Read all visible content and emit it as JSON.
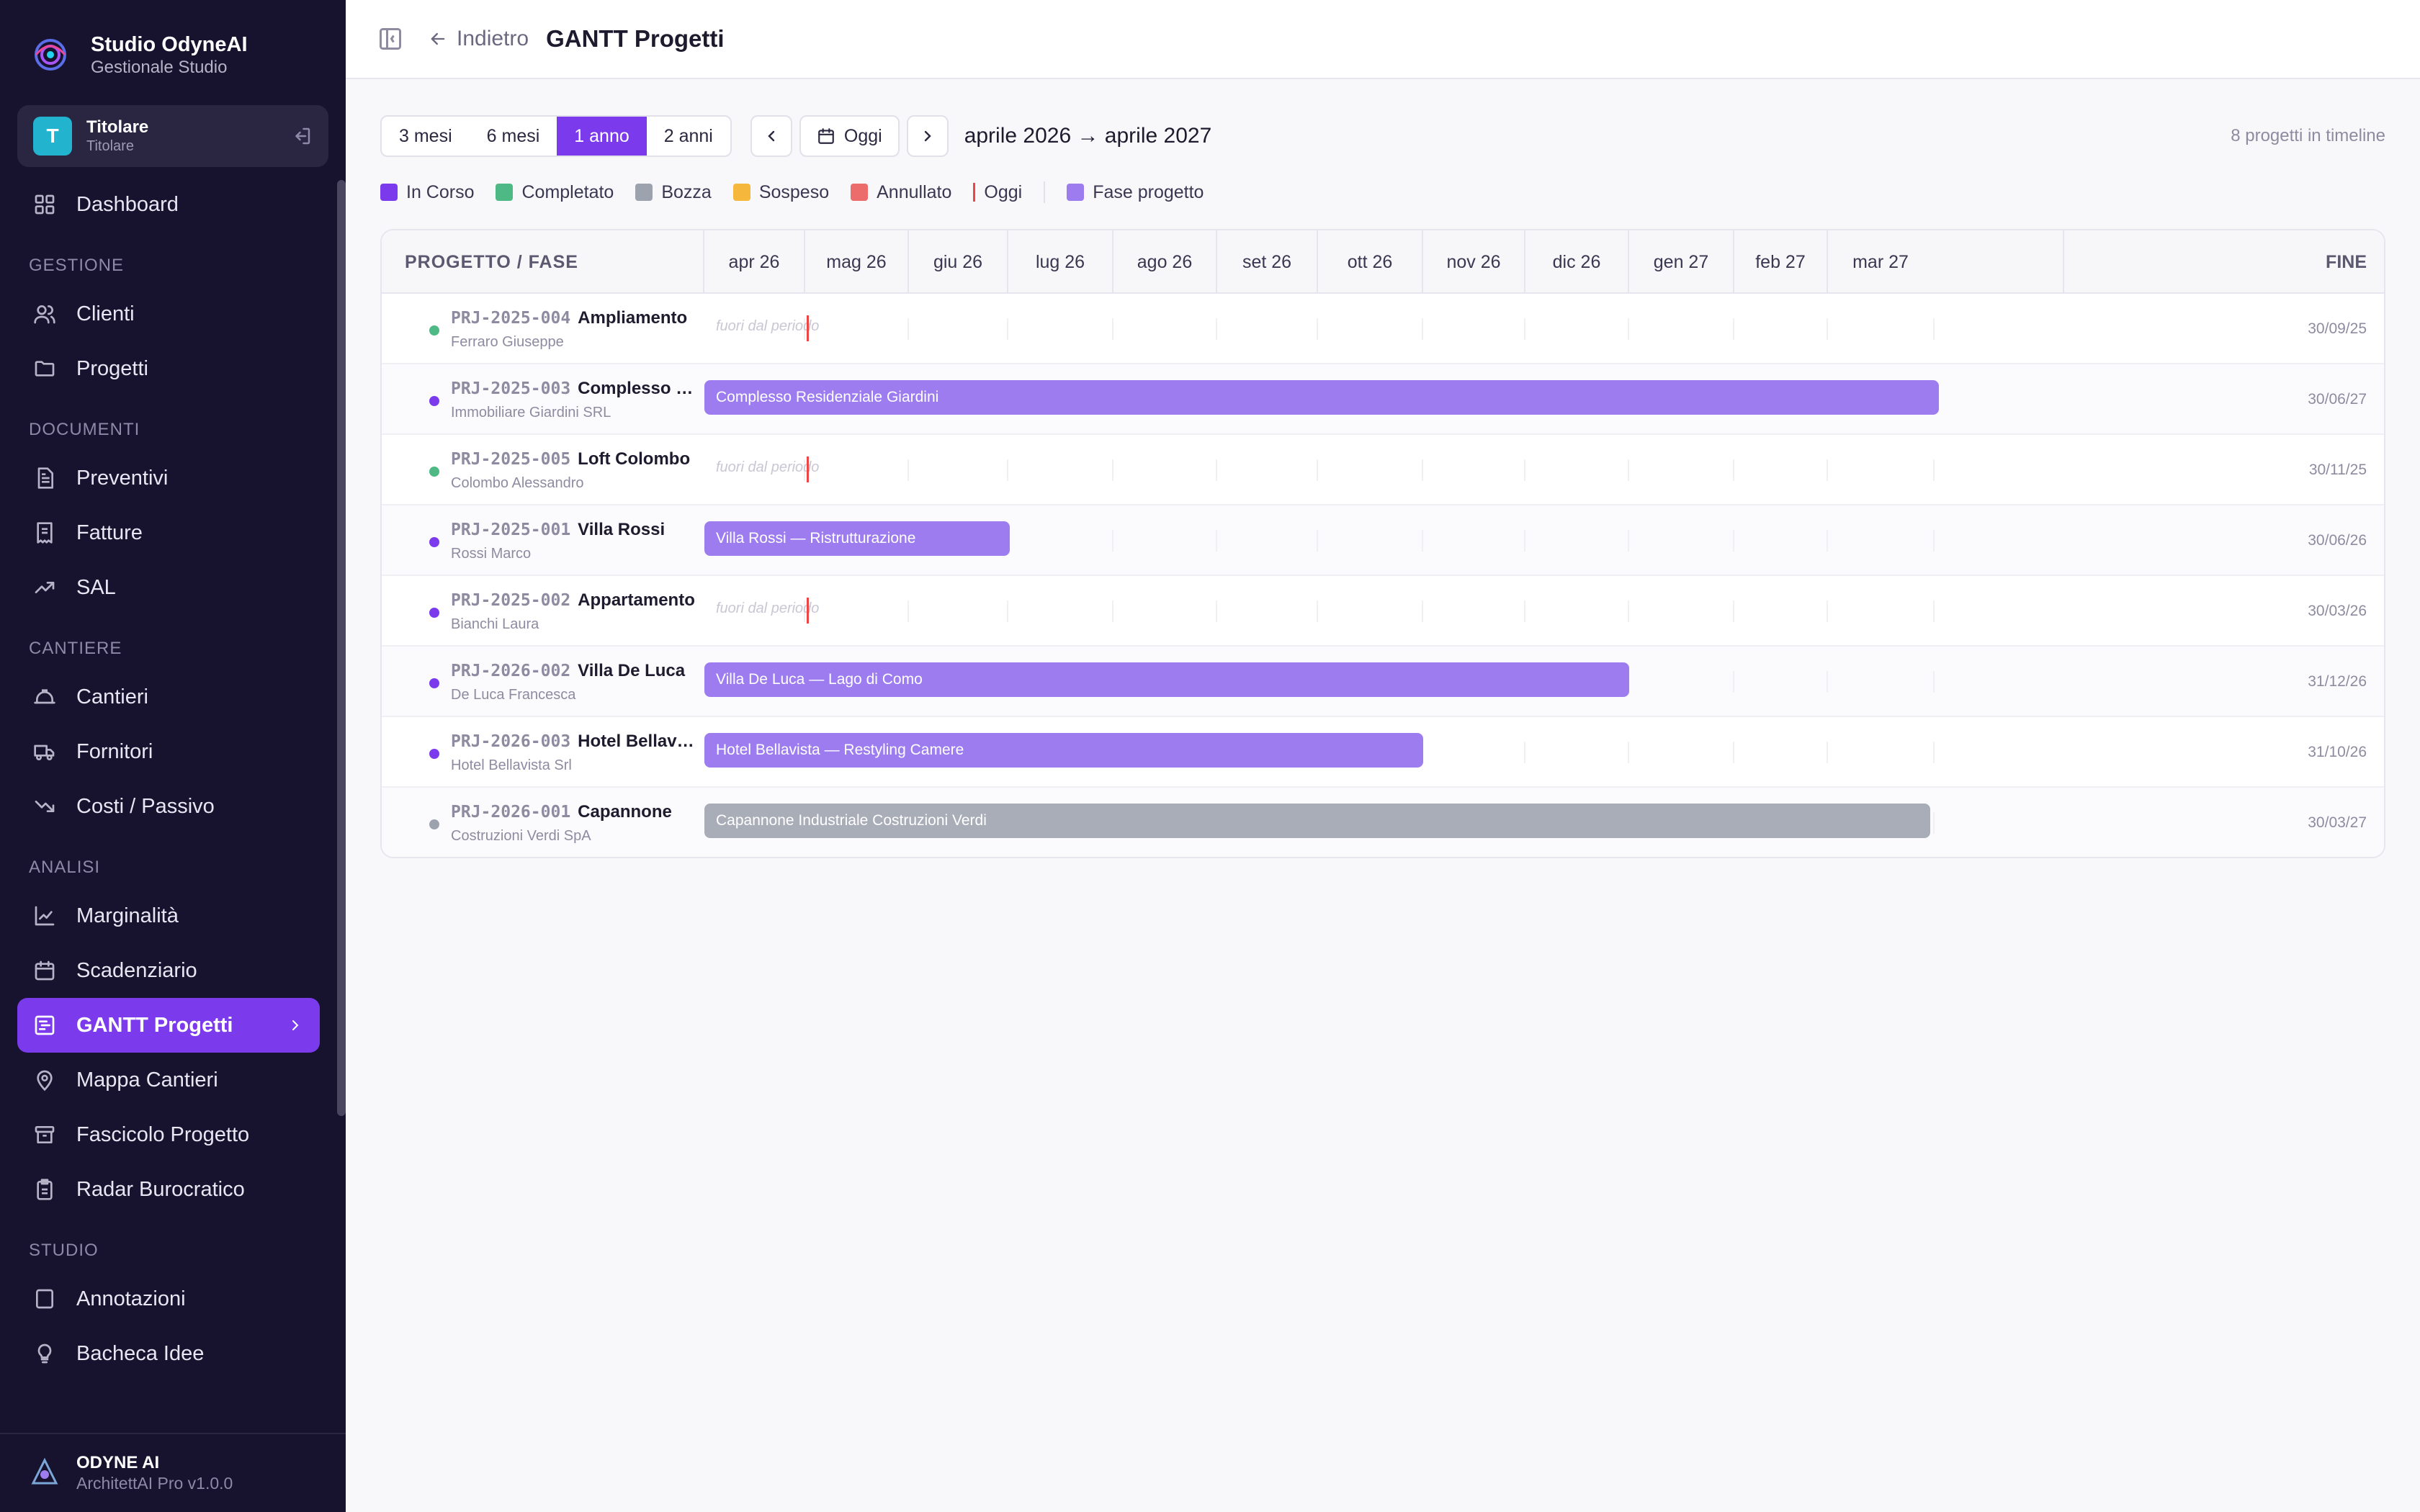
{
  "brand": {
    "title": "Studio OdyneAI",
    "subtitle": "Gestionale Studio"
  },
  "user": {
    "initial": "T",
    "name": "Titolare",
    "role": "Titolare"
  },
  "nav": {
    "dashboard": "Dashboard",
    "sections": {
      "gestione": "GESTIONE",
      "documenti": "DOCUMENTI",
      "cantiere": "CANTIERE",
      "analisi": "ANALISI",
      "studio": "STUDIO"
    },
    "clienti": "Clienti",
    "progetti": "Progetti",
    "preventivi": "Preventivi",
    "fatture": "Fatture",
    "sal": "SAL",
    "cantieri": "Cantieri",
    "fornitori": "Fornitori",
    "costi": "Costi / Passivo",
    "marginalita": "Marginalità",
    "scadenziario": "Scadenziario",
    "gantt": "GANTT Progetti",
    "mappa": "Mappa Cantieri",
    "fascicolo": "Fascicolo Progetto",
    "radar": "Radar Burocratico",
    "annotazioni": "Annotazioni",
    "bacheca": "Bacheca Idee"
  },
  "footer": {
    "title": "ODYNE AI",
    "subtitle": "ArchitettAI Pro v1.0.0"
  },
  "topbar": {
    "back": "Indietro",
    "title": "GANTT Progetti"
  },
  "controls": {
    "ranges": [
      "3 mesi",
      "6 mesi",
      "1 anno",
      "2 anni"
    ],
    "active_range": "1 anno",
    "today": "Oggi",
    "period": "aprile 2026 → aprile 2027",
    "count": "8 progetti in timeline"
  },
  "legend": {
    "in_corso": "In Corso",
    "completato": "Completato",
    "bozza": "Bozza",
    "sospeso": "Sospeso",
    "annullato": "Annullato",
    "oggi": "Oggi",
    "fase": "Fase progetto"
  },
  "colors": {
    "in_corso": "#7c3aed",
    "completato": "#4fb985",
    "bozza": "#9ca3af",
    "sospeso": "#f5b83d",
    "annullato": "#ec6b6b",
    "oggi": "#ef4444",
    "fase": "#9d7cf0",
    "bar_bozza": "#a8adb8"
  },
  "gantt": {
    "col_label": "PROGETTO / FASE",
    "end_label": "FINE",
    "months": [
      "apr 26",
      "mag 26",
      "giu 26",
      "lug 26",
      "ago 26",
      "set 26",
      "ott 26",
      "nov 26",
      "dic 26",
      "gen 27",
      "feb 27",
      "mar 27"
    ],
    "out_of_range": "fuori dal periodo",
    "rows": [
      {
        "code": "PRJ-2025-004",
        "name": "Ampliamento",
        "client": "Ferraro Giuseppe",
        "status": "completato",
        "end": "30/09/25",
        "bar": null
      },
      {
        "code": "PRJ-2025-003",
        "name": "Complesso Residenziale",
        "client": "Immobiliare Giardini SRL",
        "status": "in_corso",
        "end": "30/06/27",
        "bar": {
          "label": "Complesso Residenziale Giardini",
          "kind": "fase"
        }
      },
      {
        "code": "PRJ-2025-005",
        "name": "Loft Colombo",
        "client": "Colombo Alessandro",
        "status": "completato",
        "end": "30/11/25",
        "bar": null
      },
      {
        "code": "PRJ-2025-001",
        "name": "Villa Rossi",
        "client": "Rossi Marco",
        "status": "in_corso",
        "end": "30/06/26",
        "bar": {
          "label": "Villa Rossi — Ristrutturazione",
          "kind": "fase"
        }
      },
      {
        "code": "PRJ-2025-002",
        "name": "Appartamento",
        "client": "Bianchi Laura",
        "status": "in_corso",
        "end": "30/03/26",
        "bar": null
      },
      {
        "code": "PRJ-2026-002",
        "name": "Villa De Luca",
        "client": "De Luca Francesca",
        "status": "in_corso",
        "end": "31/12/26",
        "bar": {
          "label": "Villa De Luca — Lago di Como",
          "kind": "fase"
        }
      },
      {
        "code": "PRJ-2026-003",
        "name": "Hotel Bellavista",
        "client": "Hotel Bellavista Srl",
        "status": "in_corso",
        "end": "31/10/26",
        "bar": {
          "label": "Hotel Bellavista — Restyling Camere",
          "kind": "fase"
        }
      },
      {
        "code": "PRJ-2026-001",
        "name": "Capannone",
        "client": "Costruzioni Verdi SpA",
        "status": "bozza",
        "end": "30/03/27",
        "bar": {
          "label": "Capannone Industriale Costruzioni Verdi",
          "kind": "bozza"
        }
      }
    ]
  }
}
